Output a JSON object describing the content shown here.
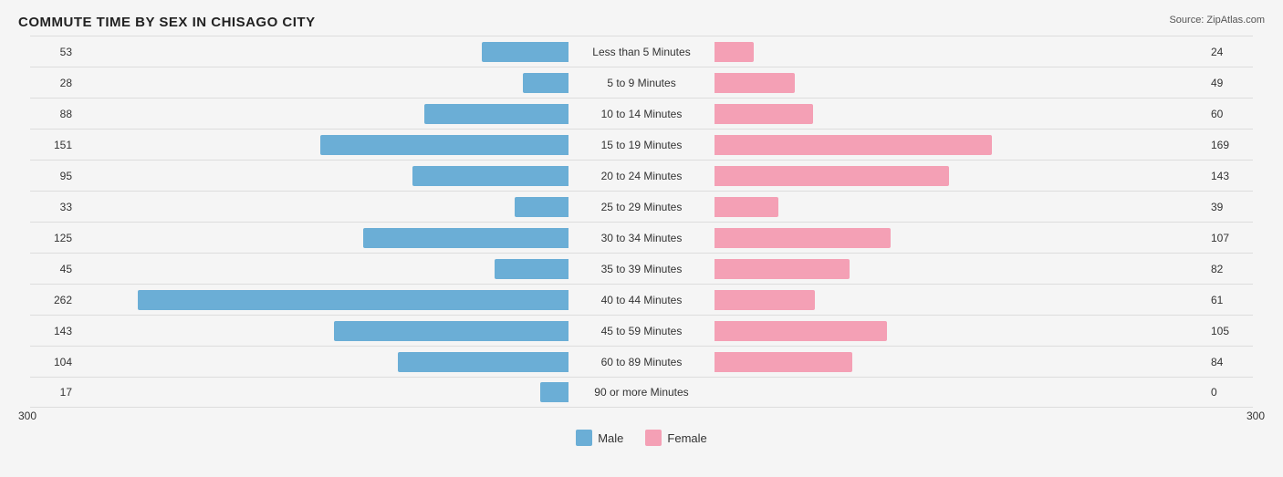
{
  "title": "COMMUTE TIME BY SEX IN CHISAGO CITY",
  "source": "Source: ZipAtlas.com",
  "colors": {
    "male": "#6baed6",
    "female": "#f4a0b5"
  },
  "legend": {
    "male_label": "Male",
    "female_label": "Female"
  },
  "axis_left": "300",
  "axis_right": "300",
  "max_value": 262,
  "rows": [
    {
      "label": "Less than 5 Minutes",
      "male": 53,
      "female": 24
    },
    {
      "label": "5 to 9 Minutes",
      "male": 28,
      "female": 49
    },
    {
      "label": "10 to 14 Minutes",
      "male": 88,
      "female": 60
    },
    {
      "label": "15 to 19 Minutes",
      "male": 151,
      "female": 169
    },
    {
      "label": "20 to 24 Minutes",
      "male": 95,
      "female": 143
    },
    {
      "label": "25 to 29 Minutes",
      "male": 33,
      "female": 39
    },
    {
      "label": "30 to 34 Minutes",
      "male": 125,
      "female": 107
    },
    {
      "label": "35 to 39 Minutes",
      "male": 45,
      "female": 82
    },
    {
      "label": "40 to 44 Minutes",
      "male": 262,
      "female": 61
    },
    {
      "label": "45 to 59 Minutes",
      "male": 143,
      "female": 105
    },
    {
      "label": "60 to 89 Minutes",
      "male": 104,
      "female": 84
    },
    {
      "label": "90 or more Minutes",
      "male": 17,
      "female": 0
    }
  ]
}
